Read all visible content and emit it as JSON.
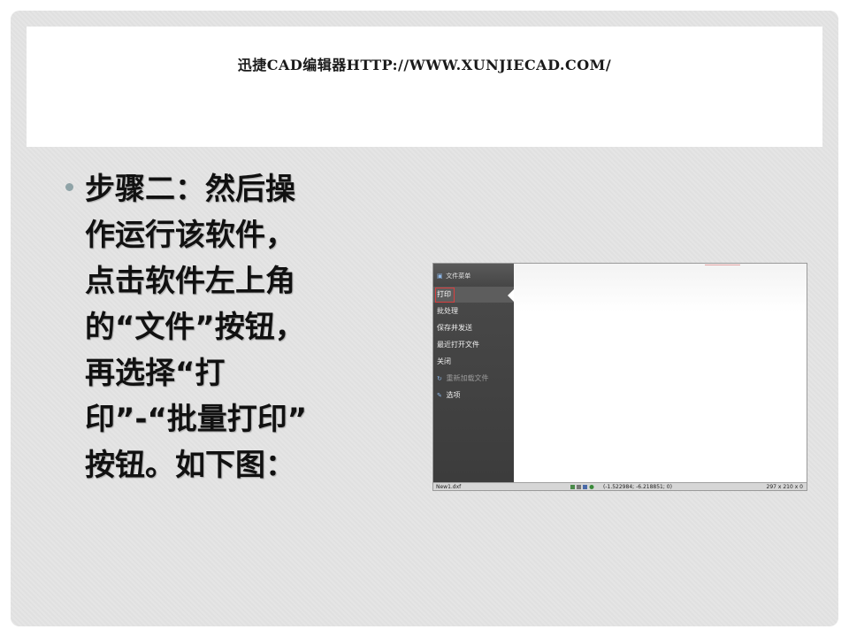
{
  "header": {
    "title": "迅捷CAD编辑器HTTP://WWW.XUNJIECAD.COM/"
  },
  "body": {
    "text": "步骤二：然后操\n作运行该软件，\n点击软件左上角\n的“文件”按钮，\n再选择“打\n印”-“批量打印”\n按钮。如下图："
  },
  "screenshot": {
    "menu_header": "文件菜单",
    "menu_items": [
      {
        "label": "打印",
        "selected": true
      },
      {
        "label": "批处理"
      },
      {
        "label": "保存并发送"
      },
      {
        "label": "最近打开文件"
      },
      {
        "label": "关闭"
      },
      {
        "label": "重新加载文件",
        "disabled": true
      },
      {
        "label": "选项"
      }
    ],
    "status": {
      "filename": "New1.dxf",
      "coords": "(-1.522984; -6.218851; 0)",
      "paper": "297 x 210 x 0"
    },
    "colors": {
      "menu_bg": "#444444",
      "highlight": "#d84040"
    }
  }
}
